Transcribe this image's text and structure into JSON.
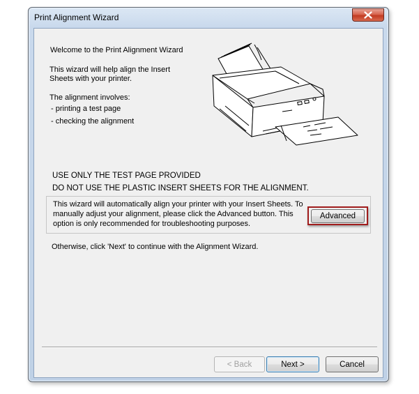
{
  "window": {
    "title": "Print Alignment Wizard",
    "close_icon": "close-icon"
  },
  "intro": {
    "welcome": "Welcome to the Print Alignment Wizard",
    "help_line1": "This wizard will help align the Insert",
    "help_line2": "Sheets with your printer.",
    "involves": "The alignment involves:",
    "step1": "- printing a test page",
    "step2": "- checking the alignment"
  },
  "printer_illustration": "printer-icon",
  "warnings": {
    "line1": "USE ONLY THE TEST PAGE PROVIDED",
    "line2": "DO NOT USE THE PLASTIC INSERT SHEETS FOR THE ALIGNMENT."
  },
  "advanced_box": {
    "line1": "This wizard will automatically align your printer with your Insert Sheets. To",
    "line2": "manually adjust your alignment, please click the Advanced button. This",
    "line3": "option is only recommended for troubleshooting purposes.",
    "button_label": "Advanced",
    "highlight_color": "#a01c1c"
  },
  "footer_note": "Otherwise, click 'Next' to continue with the Alignment Wizard.",
  "buttons": {
    "back": "< Back",
    "next": "Next >",
    "cancel": "Cancel"
  }
}
